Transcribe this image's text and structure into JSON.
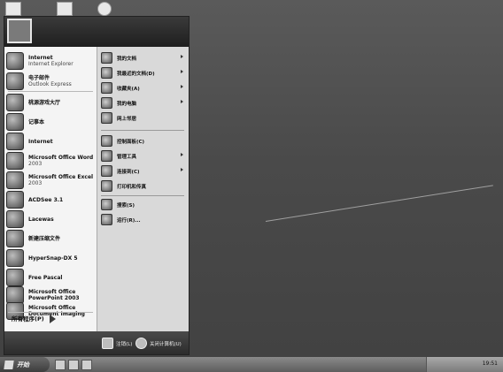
{
  "start_menu": {
    "pinned": [
      {
        "title": "Internet",
        "sub": "Internet Explorer",
        "icon": "internet-explorer-icon"
      },
      {
        "title": "电子邮件",
        "sub": "Outlook Express",
        "icon": "outlook-express-icon"
      }
    ],
    "recent": [
      {
        "title": "桃源游戏大厅",
        "sub": "",
        "icon": "game-hall-icon"
      },
      {
        "title": "记事本",
        "sub": "",
        "icon": "notepad-icon"
      },
      {
        "title": "Internet",
        "sub": "",
        "icon": "internet-icon"
      },
      {
        "title": "Microsoft Office Word",
        "sub": "2003",
        "icon": "word-icon"
      },
      {
        "title": "Microsoft Office Excel",
        "sub": "2003",
        "icon": "excel-icon"
      },
      {
        "title": "ACDSee 3.1",
        "sub": "",
        "icon": "acdsee-icon"
      },
      {
        "title": "Lacewas",
        "sub": "",
        "icon": "lacewas-icon"
      },
      {
        "title": "新建压缩文件",
        "sub": "",
        "icon": "winrar-icon"
      },
      {
        "title": "HyperSnap-DX 5",
        "sub": "",
        "icon": "hypersnap-icon"
      },
      {
        "title": "Free Pascal",
        "sub": "",
        "icon": "free-pascal-icon"
      },
      {
        "title": "Microsoft Office PowerPoint 2003",
        "sub": "",
        "icon": "powerpoint-icon"
      },
      {
        "title": "Microsoft Office Document Imaging",
        "sub": "",
        "icon": "document-imaging-icon"
      }
    ],
    "all_programs": "所有程序(P)",
    "right": [
      {
        "label": "我的文档",
        "icon": "my-documents-icon",
        "arrow": true
      },
      {
        "label": "我最近的文档(D)",
        "icon": "recent-documents-icon",
        "arrow": true
      },
      {
        "label": "收藏夹(A)",
        "icon": "favorites-icon",
        "arrow": true
      },
      {
        "label": "我的电脑",
        "icon": "my-computer-icon",
        "arrow": true
      },
      {
        "label": "网上邻居",
        "icon": "network-places-icon",
        "arrow": false
      },
      {
        "label": "控制面板(C)",
        "icon": "control-panel-icon",
        "arrow": false
      },
      {
        "label": "管理工具",
        "icon": "admin-tools-icon",
        "arrow": true
      },
      {
        "label": "连接到(C)",
        "icon": "connect-to-icon",
        "arrow": true
      },
      {
        "label": "打印机和传真",
        "icon": "printers-icon",
        "arrow": false
      },
      {
        "label": "搜索(S)",
        "icon": "search-icon",
        "arrow": false
      },
      {
        "label": "运行(R)...",
        "icon": "run-icon",
        "arrow": false
      }
    ],
    "footer": {
      "logoff": "注销(L)",
      "shutdown": "关闭计算机(U)"
    }
  },
  "taskbar": {
    "start_label": "开始",
    "clock": "19:51"
  }
}
